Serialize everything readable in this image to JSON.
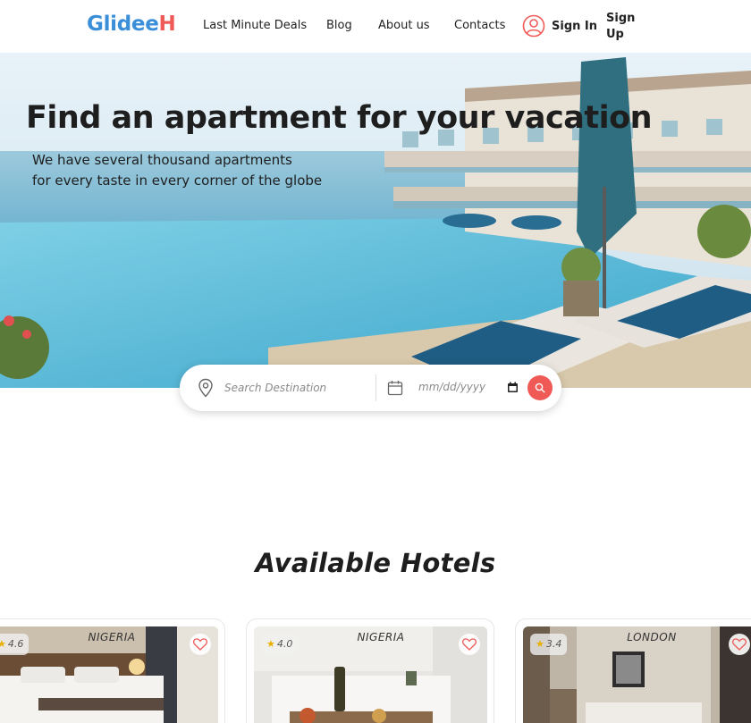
{
  "header": {
    "logo_part1": "Glidee",
    "logo_part2": "H",
    "nav": [
      "Last Minute Deals",
      "Blog",
      "About us",
      "Contacts"
    ],
    "sign_in": "Sign In",
    "sign_up": "Sign Up"
  },
  "hero": {
    "title": "Find an apartment for your vacation",
    "subtitle_line1": "We have several thousand apartments",
    "subtitle_line2": "for every taste in every corner of the globe"
  },
  "search": {
    "destination_placeholder": "Search Destination",
    "date_placeholder": "mm/dd/yyyy"
  },
  "section": {
    "title": "Available Hotels"
  },
  "hotels": [
    {
      "rating": "4.6",
      "location": "NIGERIA"
    },
    {
      "rating": "4.0",
      "location": "NIGERIA"
    },
    {
      "rating": "3.4",
      "location": "LONDON"
    }
  ],
  "colors": {
    "brand_blue": "#3b8fd9",
    "brand_red": "#ef5a57",
    "star": "#e9b000"
  }
}
